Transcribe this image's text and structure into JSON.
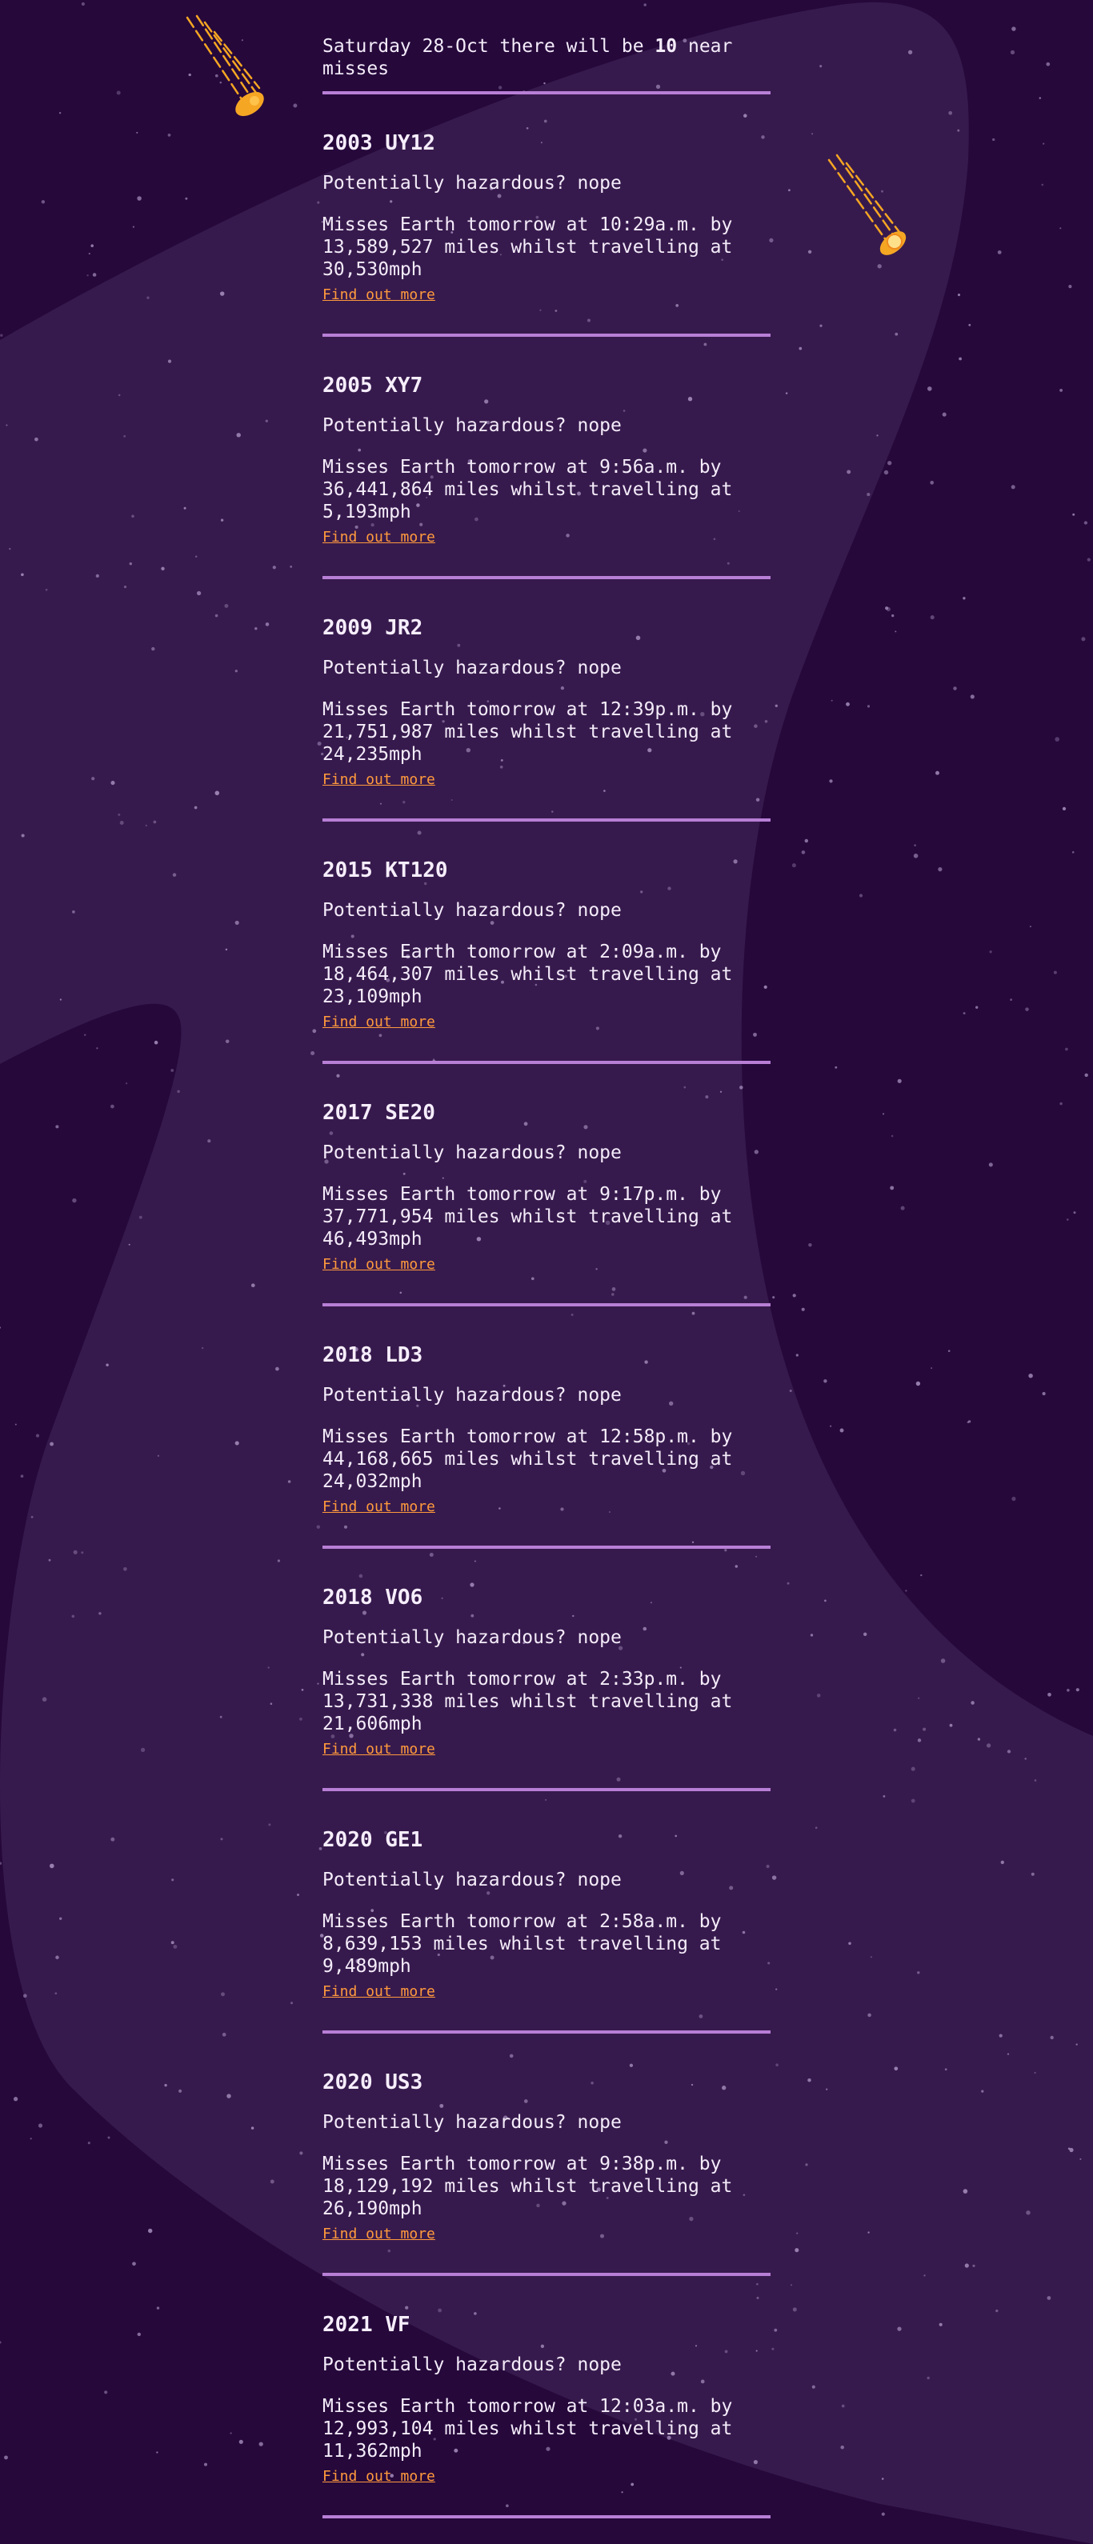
{
  "intro": {
    "prefix": "Saturday 28-Oct there will be ",
    "count": "10",
    "suffix": " near misses"
  },
  "asteroids": [
    {
      "name": "2003 UY12",
      "hazard": "Potentially hazardous? nope",
      "miss": "Misses Earth tomorrow at 10:29a.m. by 13,589,527 miles whilst travelling at 30,530mph",
      "link": "Find out more"
    },
    {
      "name": "2005 XY7",
      "hazard": "Potentially hazardous? nope",
      "miss": "Misses Earth tomorrow at 9:56a.m. by 36,441,864 miles whilst travelling at 5,193mph",
      "link": "Find out more"
    },
    {
      "name": "2009 JR2",
      "hazard": "Potentially hazardous? nope",
      "miss": "Misses Earth tomorrow at 12:39p.m. by 21,751,987 miles whilst travelling at 24,235mph",
      "link": "Find out more"
    },
    {
      "name": "2015 KT120",
      "hazard": "Potentially hazardous? nope",
      "miss": "Misses Earth tomorrow at 2:09a.m. by 18,464,307 miles whilst travelling at 23,109mph",
      "link": "Find out more"
    },
    {
      "name": "2017 SE20",
      "hazard": "Potentially hazardous? nope",
      "miss": "Misses Earth tomorrow at 9:17p.m. by 37,771,954 miles whilst travelling at 46,493mph",
      "link": "Find out more"
    },
    {
      "name": "2018 LD3",
      "hazard": "Potentially hazardous? nope",
      "miss": "Misses Earth tomorrow at 12:58p.m. by 44,168,665 miles whilst travelling at 24,032mph",
      "link": "Find out more"
    },
    {
      "name": "2018 VO6",
      "hazard": "Potentially hazardous? nope",
      "miss": "Misses Earth tomorrow at 2:33p.m. by 13,731,338 miles whilst travelling at 21,606mph",
      "link": "Find out more"
    },
    {
      "name": "2020 GE1",
      "hazard": "Potentially hazardous? nope",
      "miss": "Misses Earth tomorrow at 2:58a.m. by 8,639,153 miles whilst travelling at 9,489mph",
      "link": "Find out more"
    },
    {
      "name": "2020 US3",
      "hazard": "Potentially hazardous? nope",
      "miss": "Misses Earth tomorrow at 9:38p.m. by 18,129,192 miles whilst travelling at 26,190mph",
      "link": "Find out more"
    },
    {
      "name": "2021 VF",
      "hazard": "Potentially hazardous? nope",
      "miss": "Misses Earth tomorrow at 12:03a.m. by 12,993,104 miles whilst travelling at 11,362mph",
      "link": "Find out more"
    }
  ],
  "theme": {
    "background": "#26083b",
    "blob": "#371a4d",
    "divider": "#b87fd6",
    "link": "#ff9a3d",
    "meteor": "#f5a623"
  },
  "icons": [
    "meteor-icon",
    "meteor-icon"
  ]
}
